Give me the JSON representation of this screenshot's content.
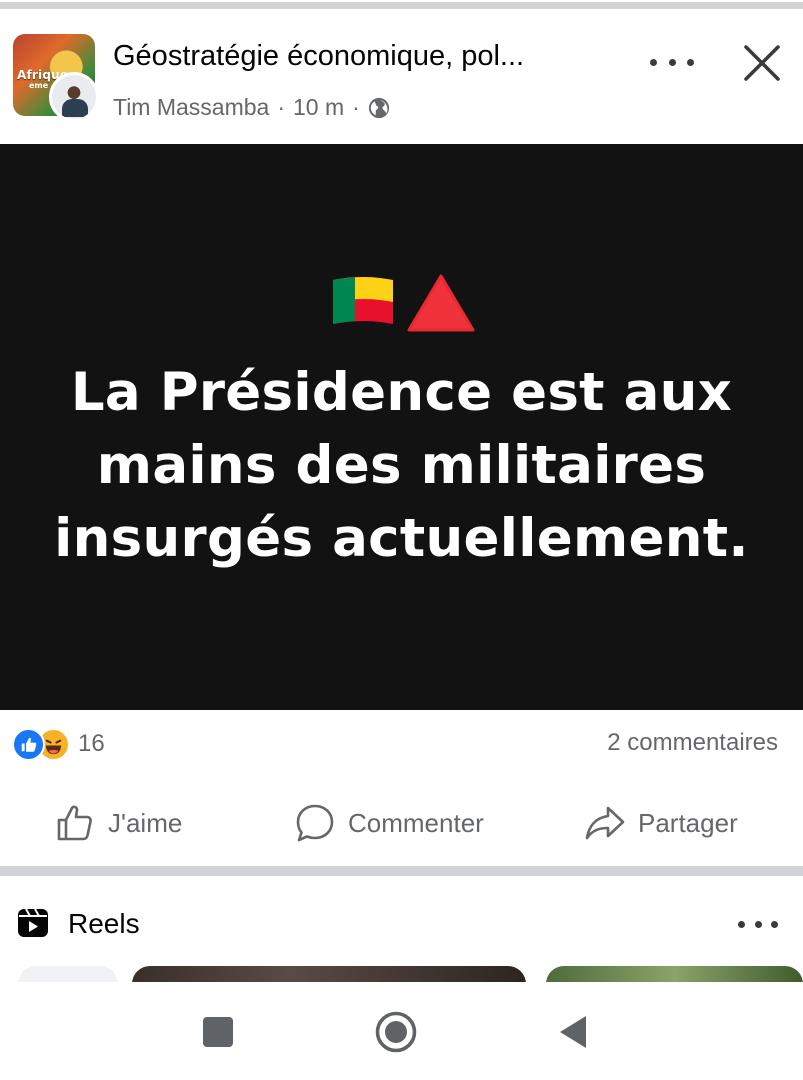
{
  "post": {
    "group_name": "Géostratégie économique, pol...",
    "author": "Tim Massamba",
    "separator": "·",
    "time": "10 m",
    "avatar_text_line1": "Afrique",
    "avatar_text_line2": "eme",
    "image_text_lines": [
      "La Présidence est aux",
      "mains des militaires",
      "insurgés actuellement."
    ],
    "emojis": [
      "benin-flag",
      "red-triangle"
    ]
  },
  "engagement": {
    "reaction_count": "16",
    "comments": "2 commentaires",
    "reactions": [
      "like",
      "haha"
    ]
  },
  "actions": {
    "like": "J'aime",
    "comment": "Commenter",
    "share": "Partager"
  },
  "reels": {
    "title": "Reels"
  },
  "colors": {
    "facebook_blue": "#1877f2",
    "image_background": "#121212",
    "secondary_text": "#65676b",
    "divider": "#d1d3d6"
  }
}
